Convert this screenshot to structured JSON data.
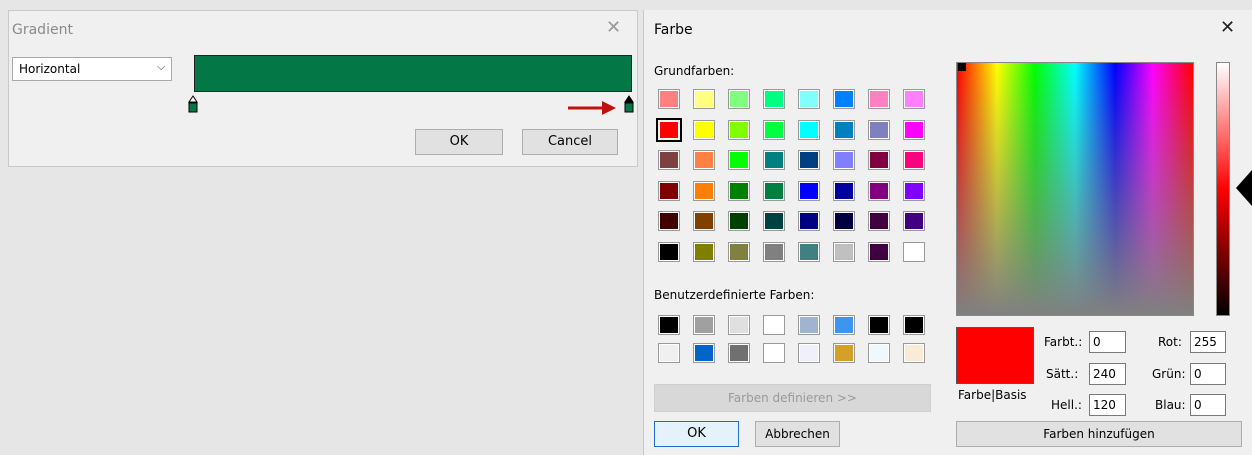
{
  "gradient": {
    "title": "Gradient",
    "close_glyph": "✕",
    "direction": "Horizontal",
    "chevron": "⌵",
    "bar_color": "#037746",
    "ok_label": "OK",
    "cancel_label": "Cancel",
    "arrow_color": "#c0120c"
  },
  "farbe": {
    "title": "Farbe",
    "close_glyph": "✕",
    "basic_label": "Grundfarben:",
    "custom_label": "Benutzerdefinierte Farben:",
    "basic_colors": [
      [
        "#ff8080",
        "#ffff80",
        "#80ff80",
        "#00ff80",
        "#80ffff",
        "#0080ff",
        "#ff80c0",
        "#ff80ff"
      ],
      [
        "#ff0000",
        "#ffff00",
        "#80ff00",
        "#00ff40",
        "#00ffff",
        "#0080c0",
        "#8080c0",
        "#ff00ff"
      ],
      [
        "#804040",
        "#ff8040",
        "#00ff00",
        "#008080",
        "#004080",
        "#8080ff",
        "#800040",
        "#ff0080"
      ],
      [
        "#800000",
        "#ff8000",
        "#008000",
        "#008040",
        "#0000ff",
        "#0000a0",
        "#800080",
        "#8000ff"
      ],
      [
        "#400000",
        "#804000",
        "#004000",
        "#004040",
        "#000080",
        "#000040",
        "#400040",
        "#400080"
      ],
      [
        "#000000",
        "#808000",
        "#808040",
        "#808080",
        "#408080",
        "#c0c0c0",
        "#400040",
        "#ffffff"
      ]
    ],
    "selected_basic": "#ff0000",
    "custom_colors": [
      [
        "#000000",
        "#a0a0a0",
        "#e0e0e0",
        "#ffffff",
        "#a0b4d2",
        "#3c96f0",
        "#000000",
        "#000000"
      ],
      [
        "#f0f0f0",
        "#0064c8",
        "#707070",
        "#ffffff",
        "#f0f0fa",
        "#d4a028",
        "#f0f8ff",
        "#faebd7"
      ]
    ],
    "define_label": "Farben definieren >>",
    "ok_label": "OK",
    "cancel_label": "Abbrechen",
    "preview_color": "#ff0000",
    "preview_label": "Farbe|Basis",
    "hue_label": "Farbt.:",
    "hue": "0",
    "sat_label": "Sätt.:",
    "sat": "240",
    "lum_label": "Hell.:",
    "lum": "120",
    "red_label": "Rot:",
    "red": "255",
    "green_label": "Grün:",
    "green": "0",
    "blue_label": "Blau:",
    "blue": "0",
    "add_label": "Farben hinzufügen"
  }
}
